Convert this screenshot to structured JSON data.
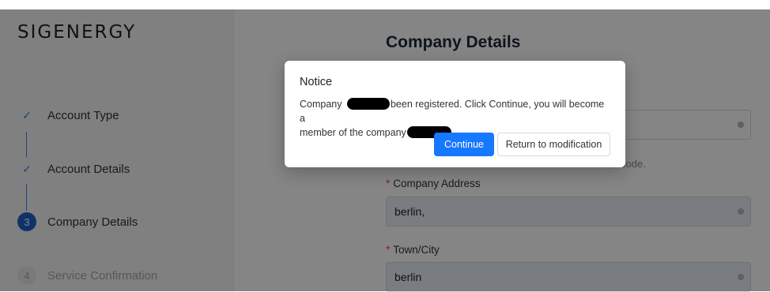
{
  "logo": "SIGENERGY",
  "steps": [
    {
      "index": "✓",
      "label": "Account Type",
      "state": "done"
    },
    {
      "index": "✓",
      "label": "Account Details",
      "state": "done"
    },
    {
      "index": "3",
      "label": "Company Details",
      "state": "active"
    },
    {
      "index": "4",
      "label": "Service Confirmation",
      "state": "todo"
    }
  ],
  "main": {
    "title": "Company Details",
    "hint_suffix": "code.",
    "fields": [
      {
        "label": "",
        "value": ""
      },
      {
        "label": "Company Address",
        "value": "berlin,"
      },
      {
        "label": "Town/City",
        "value": "berlin"
      }
    ],
    "required_mark": "*"
  },
  "modal": {
    "title": "Notice",
    "line1_prefix": "Company",
    "line1_suffix": "been registered. Click Continue, you will become a",
    "line2_prefix": "member of the company",
    "continue_label": "Continue",
    "return_label": "Return to modification"
  },
  "colors": {
    "accent": "#1677ff",
    "step_active": "#1e63c9",
    "step_done": "#3c7fe4",
    "required": "#e2463f"
  }
}
